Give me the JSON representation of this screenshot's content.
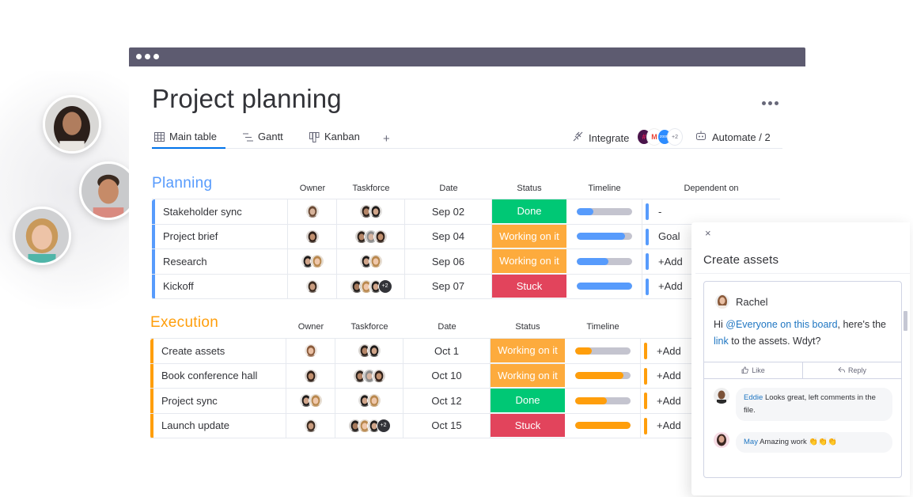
{
  "window": {
    "dots": 3
  },
  "board": {
    "title": "Project planning",
    "tabs": [
      {
        "label": "Main table",
        "icon": "table-icon",
        "active": true
      },
      {
        "label": "Gantt",
        "icon": "gantt-icon",
        "active": false
      },
      {
        "label": "Kanban",
        "icon": "kanban-icon",
        "active": false
      }
    ],
    "add_tab_label": "+",
    "integrate_label": "Integrate",
    "integrations": [
      {
        "name": "slack",
        "bg": "#4a154b",
        "glyph": "#"
      },
      {
        "name": "gmail",
        "bg": "#ffffff",
        "glyph": "M"
      },
      {
        "name": "zoom",
        "bg": "#2d8cff",
        "glyph": "zoom"
      },
      {
        "name": "more",
        "bg": "#ffffff",
        "glyph": "+2"
      }
    ],
    "automate_label": "Automate / 2"
  },
  "columns": {
    "owner": "Owner",
    "taskforce": "Taskforce",
    "date": "Date",
    "status": "Status",
    "timeline": "Timeline",
    "dependent_on": "Dependent on"
  },
  "status_colors": {
    "Done": "#00c875",
    "Working on it": "#fdab3d",
    "Stuck": "#e2445c"
  },
  "groups": [
    {
      "title": "Planning",
      "color": "#579bfc",
      "rows": [
        {
          "name": "Stakeholder sync",
          "owner": [
            "p1"
          ],
          "taskforce": [
            "p2",
            "p3"
          ],
          "taskforce_more": "",
          "date": "Sep 02",
          "status": "Done",
          "timeline_progress": 0.3,
          "dependent_on": "-"
        },
        {
          "name": "Project brief",
          "owner": [
            "p4"
          ],
          "taskforce": [
            "p2",
            "p5",
            "p4"
          ],
          "taskforce_more": "",
          "date": "Sep 04",
          "status": "Working on it",
          "timeline_progress": 0.88,
          "dependent_on": "Goal"
        },
        {
          "name": "Research",
          "owner": [
            "p3",
            "p6"
          ],
          "taskforce": [
            "p3",
            "p6"
          ],
          "taskforce_more": "",
          "date": "Sep 06",
          "status": "Working on it",
          "timeline_progress": 0.58,
          "dependent_on": "+Add"
        },
        {
          "name": "Kickoff",
          "owner": [
            "p7"
          ],
          "taskforce": [
            "p8",
            "p6",
            "p3"
          ],
          "taskforce_more": "+2",
          "date": "Sep 07",
          "status": "Stuck",
          "timeline_progress": 1.0,
          "dependent_on": "+Add"
        }
      ]
    },
    {
      "title": "Execution",
      "color": "#ff9e0b",
      "rows": [
        {
          "name": "Create assets",
          "owner": [
            "p9"
          ],
          "taskforce": [
            "p2",
            "p3"
          ],
          "taskforce_more": "",
          "date": "Oct 1",
          "status": "Working on it",
          "timeline_progress": 0.3,
          "dependent_on": "+Add"
        },
        {
          "name": "Book conference hall",
          "owner": [
            "p4"
          ],
          "taskforce": [
            "p2",
            "p5",
            "p4"
          ],
          "taskforce_more": "",
          "date": "Oct 10",
          "status": "Working on it",
          "timeline_progress": 0.88,
          "dependent_on": "+Add"
        },
        {
          "name": "Project sync",
          "owner": [
            "p3",
            "p6"
          ],
          "taskforce": [
            "p3",
            "p6"
          ],
          "taskforce_more": "",
          "date": "Oct 12",
          "status": "Done",
          "timeline_progress": 0.58,
          "dependent_on": "+Add"
        },
        {
          "name": "Launch update",
          "owner": [
            "p7"
          ],
          "taskforce": [
            "p8",
            "p6",
            "p3"
          ],
          "taskforce_more": "+2",
          "date": "Oct 15",
          "status": "Stuck",
          "timeline_progress": 1.0,
          "dependent_on": "+Add"
        }
      ]
    }
  ],
  "panel": {
    "close_label": "×",
    "title": "Create assets",
    "post": {
      "author": "Rachel",
      "body_prefix": "Hi ",
      "mention": "@Everyone on this board",
      "body_mid": ", here's the ",
      "link_text": "link",
      "body_suffix": " to the assets. Wdyt?",
      "like_label": "Like",
      "reply_label": "Reply"
    },
    "replies": [
      {
        "author": "Eddie",
        "text": " Looks great, left comments in the file."
      },
      {
        "author": "May",
        "text": " Amazing work 👏👏👏"
      }
    ]
  }
}
